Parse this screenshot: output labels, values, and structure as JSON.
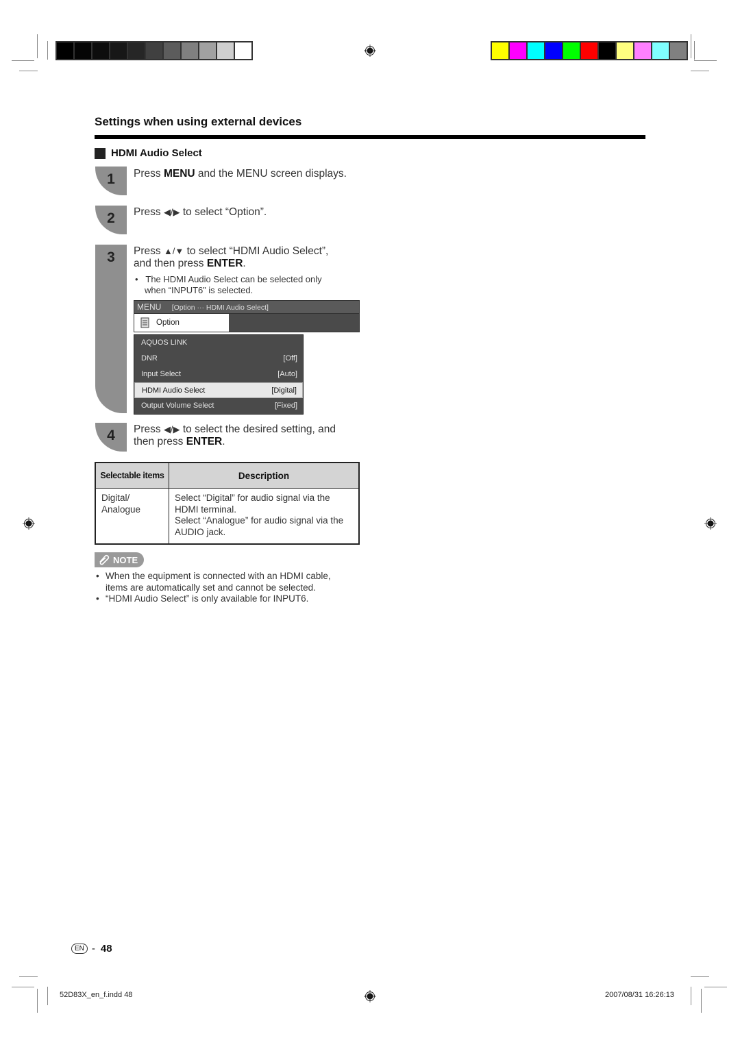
{
  "calibration": {
    "gray_swatches": [
      "#000000",
      "#050505",
      "#0d0d0d",
      "#171717",
      "#262626",
      "#404040",
      "#5c5c5c",
      "#808080",
      "#a1a1a1",
      "#cfcfcf",
      "#ffffff"
    ],
    "color_swatches": [
      "#ffff00",
      "#ff00ff",
      "#00ffff",
      "#0000ff",
      "#00ff00",
      "#ff0000",
      "#000000",
      "#ffff80",
      "#ff80ff",
      "#80ffff",
      "#808080"
    ]
  },
  "page": {
    "title": "Settings when using external devices",
    "section": "HDMI Audio Select",
    "steps": [
      {
        "num": "1",
        "pre": "Press ",
        "bold": "MENU",
        "post": " and the MENU screen displays."
      },
      {
        "num": "2",
        "pre": "Press ",
        "arrows": "◀/▶",
        "post": " to select “Option”."
      },
      {
        "num": "3",
        "pre": "Press ",
        "arrows": "▲/▼",
        "post": " to select “HDMI Audio Select”,",
        "line2_pre": "and then press ",
        "line2_bold": "ENTER",
        "line2_post": ".",
        "bullet": "The HDMI Audio Select can be selected only",
        "bullet_line2": "when “INPUT6” is selected."
      },
      {
        "num": "4",
        "pre": "Press ",
        "arrows": "◀/▶",
        "post": " to select the desired setting, and",
        "line2_pre": "then press ",
        "line2_bold": "ENTER",
        "line2_post": "."
      }
    ]
  },
  "menu_screen": {
    "header_label": "MENU",
    "breadcrumb": "[Option ··· HDMI Audio Select]",
    "tab_label": "Option",
    "tab_icon": "notepad-icon",
    "items": [
      {
        "label": "AQUOS LINK",
        "value": ""
      },
      {
        "label": "DNR",
        "value": "[Off]"
      },
      {
        "label": "Input Select",
        "value": "[Auto]"
      },
      {
        "label": "HDMI Audio Select",
        "value": "[Digital]",
        "selected": true
      },
      {
        "label": "Output Volume Select",
        "value": "[Fixed]"
      }
    ]
  },
  "table": {
    "headers": [
      "Selectable items",
      "Description"
    ],
    "rows": [
      {
        "item_l1": "Digital/",
        "item_l2": "Analogue",
        "desc": [
          "Select “Digital” for audio signal via the",
          "HDMI terminal.",
          "Select “Analogue” for audio signal via the",
          "AUDIO jack."
        ]
      }
    ]
  },
  "note": {
    "label": "NOTE",
    "bullets": [
      {
        "l1": "When the equipment is connected with an HDMI cable,",
        "l2": "items are automatically set and cannot be selected."
      },
      {
        "l1": "“HDMI Audio Select” is only available for INPUT6.",
        "l2": ""
      }
    ]
  },
  "footer": {
    "lang_badge": "EN",
    "separator": "-",
    "page_number": "48",
    "file_name": "52D83X_en_f.indd  48",
    "timestamp": "2007/08/31   16:26:13"
  }
}
